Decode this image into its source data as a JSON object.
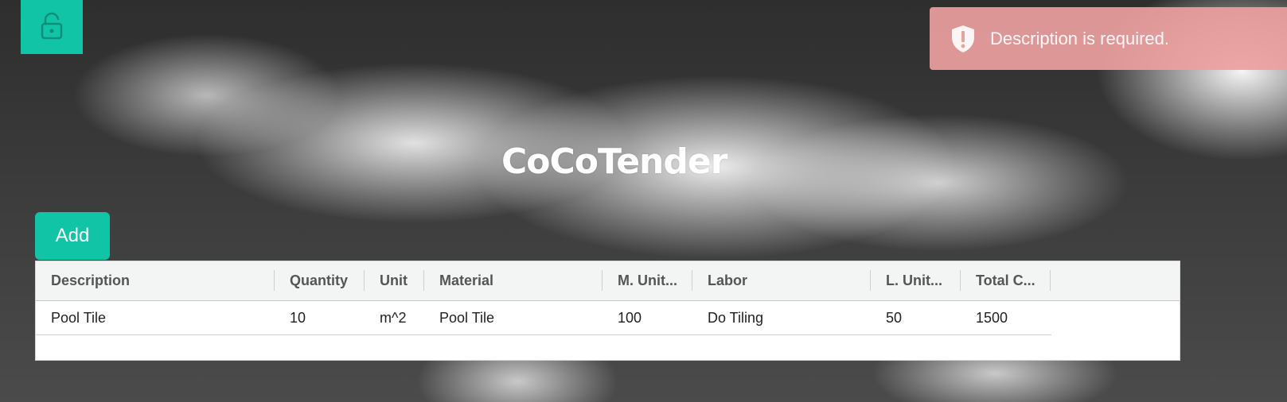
{
  "app": {
    "title": "CoCoTender"
  },
  "toolbar": {
    "lock_icon": "lock-icon",
    "add_label": "Add"
  },
  "toast": {
    "message": "Description is required.",
    "icon": "shield-exclamation-icon",
    "color": "#e8a0a0"
  },
  "colors": {
    "accent": "#11c4a6"
  },
  "table": {
    "columns": [
      "Description",
      "Quantity",
      "Unit",
      "Material",
      "M. Unit...",
      "Labor",
      "L. Unit...",
      "Total C..."
    ],
    "rows": [
      [
        "Pool Tile",
        "10",
        "m^2",
        "Pool Tile",
        "100",
        "Do Tiling",
        "50",
        "1500"
      ]
    ]
  }
}
